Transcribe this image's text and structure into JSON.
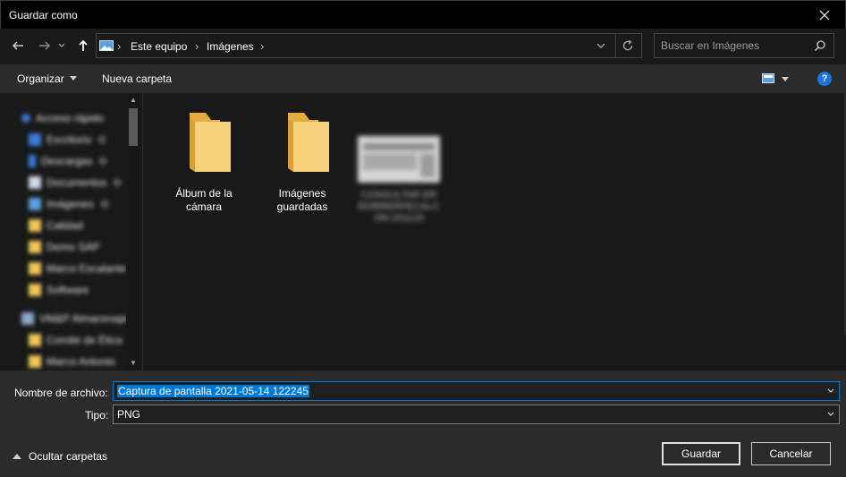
{
  "window": {
    "title": "Guardar como"
  },
  "nav": {
    "breadcrumb": [
      "Este equipo",
      "Imágenes"
    ],
    "search_placeholder": "Buscar en Imágenes"
  },
  "toolbar": {
    "organize_label": "Organizar",
    "new_folder_label": "Nueva carpeta",
    "help_label": "?"
  },
  "sidebar": {
    "items": [
      {
        "label": "Acceso rápido",
        "icon": "star-icon"
      },
      {
        "label": "Escritorio",
        "icon": "desktop-icon"
      },
      {
        "label": "Descargas",
        "icon": "download-icon"
      },
      {
        "label": "Documentos",
        "icon": "document-icon"
      },
      {
        "label": "Imágenes",
        "icon": "pictures-icon"
      },
      {
        "label": "Calidad",
        "icon": "folder-icon"
      },
      {
        "label": "Demo SAP",
        "icon": "folder-icon"
      },
      {
        "label": "Marco Escalante",
        "icon": "folder-icon"
      },
      {
        "label": "Software",
        "icon": "folder-icon"
      },
      {
        "label": "VM&P Almacenaje",
        "icon": "network-icon"
      },
      {
        "label": "Comité de Ética",
        "icon": "folder-icon"
      },
      {
        "label": "Marco Antonio",
        "icon": "folder-icon"
      }
    ]
  },
  "files": [
    {
      "name": "Álbum de la cámara",
      "type": "folder"
    },
    {
      "name": "Imágenes guardadas",
      "type": "folder"
    },
    {
      "name": "CONSULTAR ER RORRERFECALC ON 201123",
      "type": "image"
    }
  ],
  "form": {
    "filename_label": "Nombre de archivo:",
    "filename_value": "Captura de pantalla 2021-05-14 122245",
    "type_label": "Tipo:",
    "type_value": "PNG"
  },
  "footer": {
    "hide_folders_label": "Ocultar carpetas",
    "save_label": "Guardar",
    "cancel_label": "Cancelar"
  },
  "colors": {
    "accent": "#0078d7",
    "folder": "#f3c55a",
    "help": "#1e73d8"
  }
}
